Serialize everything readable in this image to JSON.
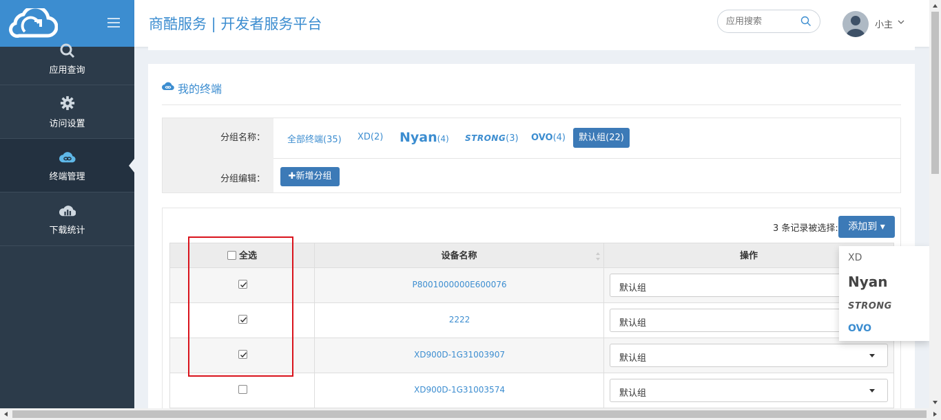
{
  "sidebar": {
    "items": [
      {
        "label": "应用查询",
        "icon": "search-icon"
      },
      {
        "label": "访问设置",
        "icon": "gear-icon"
      },
      {
        "label": "终端管理",
        "icon": "cloud-link-icon",
        "active": true
      },
      {
        "label": "下载统计",
        "icon": "chart-cloud-icon"
      }
    ]
  },
  "header": {
    "title": "商酷服务 | 开发者服务平台",
    "search_placeholder": "应用搜索",
    "user_name": "小主"
  },
  "panel": {
    "title": "我的终端",
    "filter": {
      "group_name_label": "分组名称：",
      "group_edit_label": "分组编辑：",
      "groups": [
        {
          "name": "全部终端",
          "count": "(35)"
        },
        {
          "name": "XD",
          "count": "(2)"
        },
        {
          "name": "Nyan",
          "count": "(4)"
        },
        {
          "name": "STRONG",
          "count": "(3)"
        },
        {
          "name": "OVO",
          "count": "(4)"
        }
      ],
      "active_group": "默认组(22)",
      "add_group_button": "✚新增分组"
    },
    "selection_text": "3 条记录被选择:",
    "add_to_button": "添加到 ▾",
    "add_to_menu": [
      "XD",
      "Nyan",
      "STRONG",
      "OVO"
    ]
  },
  "table": {
    "headers": {
      "select_all": "全选",
      "device_name": "设备名称",
      "action": "操作"
    },
    "rows": [
      {
        "checked": true,
        "device": "P8001000000E600076",
        "group": "默认组"
      },
      {
        "checked": true,
        "device": "2222",
        "group": "默认组"
      },
      {
        "checked": true,
        "device": "XD900D-1G31003907",
        "group": "默认组"
      },
      {
        "checked": false,
        "device": "XD900D-1G31003574",
        "group": "默认组"
      }
    ]
  },
  "colors": {
    "brand_blue": "#3c8dd0",
    "button_blue": "#3c7ab7",
    "sidebar_bg": "#2c3b4a",
    "highlight_red": "#d9121b"
  }
}
